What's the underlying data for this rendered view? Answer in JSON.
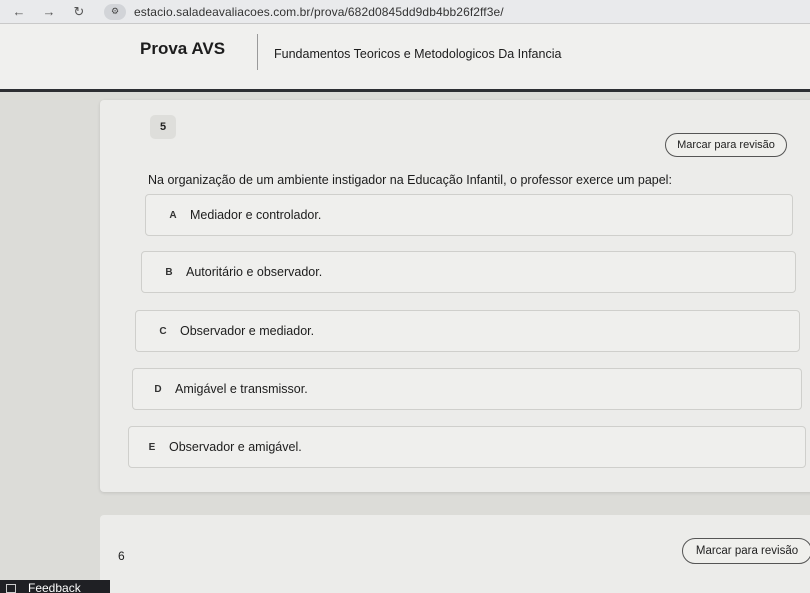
{
  "browser": {
    "url": "estacio.saladeavaliacoes.com.br/prova/682d0845dd9db4bb26f2ff3e/",
    "back_icon": "←",
    "forward_icon": "→",
    "reload_icon": "↻",
    "site_icon": "⚙"
  },
  "header": {
    "title": "Prova AVS",
    "subject": "Fundamentos Teoricos e Metodologicos Da Infancia"
  },
  "question": {
    "number": "5",
    "review_label": "Marcar para revisão",
    "text": "Na organização de um ambiente instigador na Educação Infantil, o professor exerce um papel:",
    "options": [
      {
        "letter": "A",
        "text": "Mediador e controlador."
      },
      {
        "letter": "B",
        "text": "Autoritário e observador."
      },
      {
        "letter": "C",
        "text": "Observador e mediador."
      },
      {
        "letter": "D",
        "text": "Amigável e transmissor."
      },
      {
        "letter": "E",
        "text": "Observador e amigável."
      }
    ]
  },
  "next_question": {
    "number": "6",
    "review_label": "Marcar para revisão"
  },
  "feedback": {
    "label": "Feedback"
  }
}
